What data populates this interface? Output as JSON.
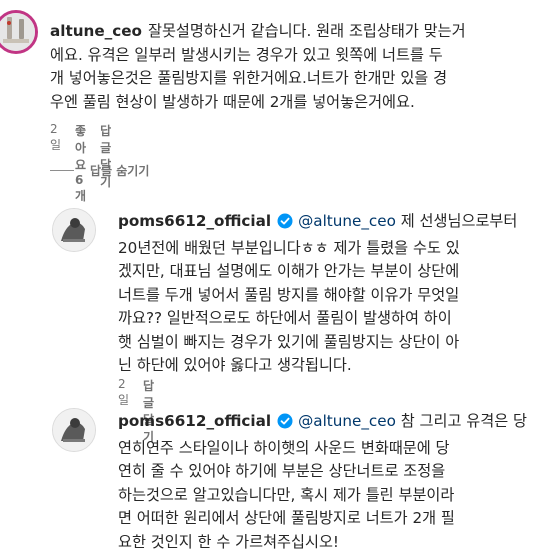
{
  "comment1": {
    "username": "altune_ceo",
    "text": "잘못설명하신거 같습니다. 원래 조립상태가 맞는거\n에요. 유격은 일부러 발생시키는 경우가 있고 윗쪽에 너트를 두\n개 넣어놓은것은 풀림방지를 위한거에요.너트가 한개만 있을 경\n우엔 풀림 현상이 발생하가 때문에 2개를 넣어놓은거에요.",
    "time": "2일",
    "likes": "좋아요 6개",
    "reply": "답글 달기"
  },
  "hide_replies_label": "답글 숨기기",
  "reply1": {
    "username": "poms6612_official",
    "mention": "@altune_ceo",
    "text": " 제 선생님으로부터\n20년전에 배웠던 부분입니다ㅎㅎ 제가 틀렸을 수도 있\n겠지만, 대표님 설명에도 이해가 안가는 부분이 상단에\n너트를 두개 넣어서 풀림 방지를 해야할 이유가 무엇일\n까요?? 일반적으로도 하단에서 풀림이 발생하여 하이\n햇 심벌이 빠지는 경우가 있기에 풀림방지는 상단이 아\n닌 하단에 있어야 옳다고 생각됩니다.",
    "time": "2일",
    "reply": "답글 달기"
  },
  "reply2": {
    "username": "poms6612_official",
    "mention": "@altune_ceo",
    "text": " 참 그리고 유격은 당\n연히연주 스타일이나 하이햇의 사운드 변화때문에 당\n연히 줄 수 있어야 하기에 부분은 상단너트로 조정을\n하는것으로 알고있습니다만, 혹시 제가 틀린 부분이라\n면 어떠한 원리에서 상단에 풀림방지로 너트가 2개 필\n요한 것인지 한 수 가르쳐주십시오!"
  },
  "colors": {
    "verified": "#0095f6",
    "mention": "#00376b",
    "meta": "#737373"
  }
}
